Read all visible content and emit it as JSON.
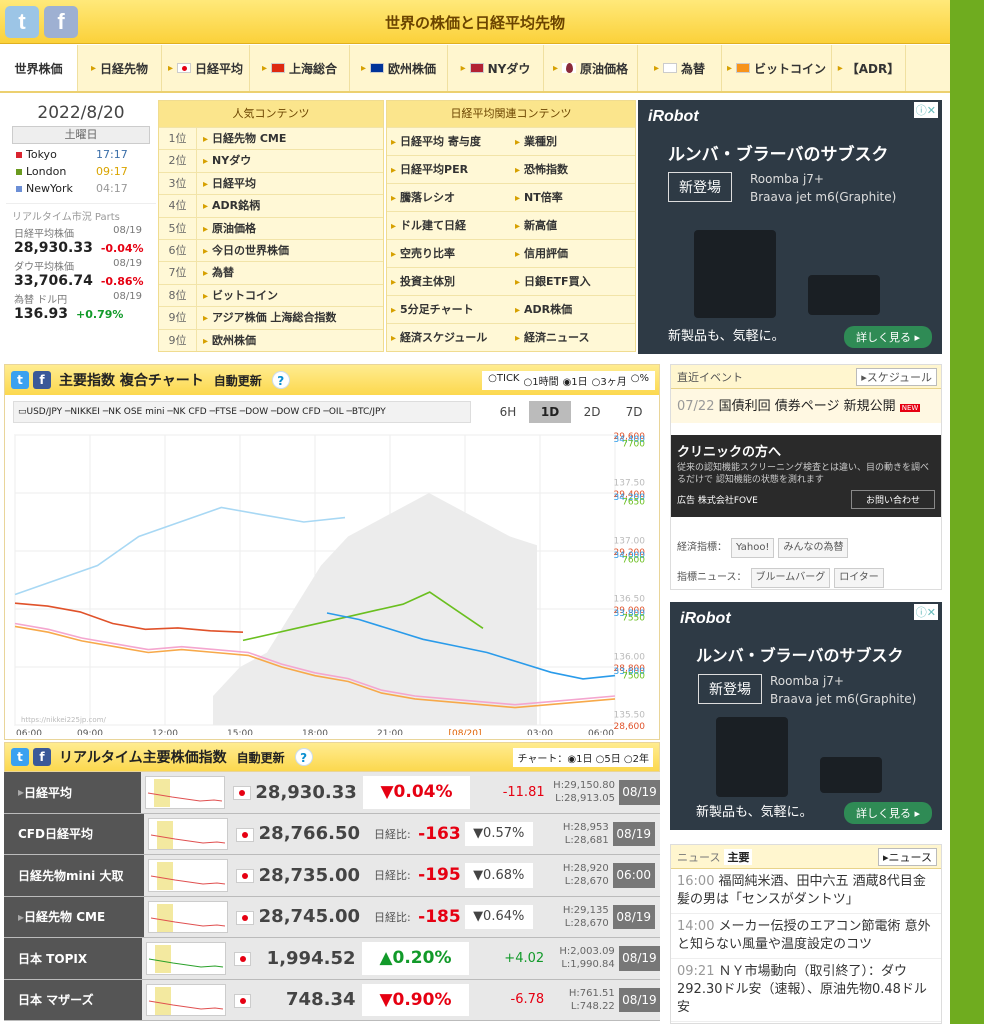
{
  "header": {
    "title": "世界の株価と日経平均先物",
    "twitter_label": "t",
    "facebook_label": "f"
  },
  "nav": [
    {
      "label": "世界株価",
      "flag": ""
    },
    {
      "label": "日経先物",
      "flag": ""
    },
    {
      "label": "日経平均",
      "flag": "jp"
    },
    {
      "label": "上海総合",
      "flag": "cn"
    },
    {
      "label": "欧州株価",
      "flag": "eu"
    },
    {
      "label": "NYダウ",
      "flag": "us"
    },
    {
      "label": "原油価格",
      "flag": "oil"
    },
    {
      "label": "為替",
      "flag": "fx"
    },
    {
      "label": "ビットコイン",
      "flag": "btc"
    },
    {
      "label": "【ADR】",
      "flag": ""
    }
  ],
  "clock": {
    "date": "2022/8/20",
    "weekday": "土曜日",
    "cities": [
      {
        "name": "Tokyo",
        "time": "17:17",
        "color": "#d9242f"
      },
      {
        "name": "London",
        "time": "09:17",
        "color": "#6a9a1f"
      },
      {
        "name": "NewYork",
        "time": "04:17",
        "color": "#6c8fd6"
      }
    ],
    "parts_label": "リアルタイム市況 Parts"
  },
  "mini_quotes": [
    {
      "label": "日経平均株価",
      "date": "08/19",
      "value": "28,930.33",
      "change": "-0.04%",
      "dir": "down"
    },
    {
      "label": "ダウ平均株価",
      "date": "08/19",
      "value": "33,706.74",
      "change": "-0.86%",
      "dir": "down"
    },
    {
      "label": "為替 ドル円",
      "date": "08/19",
      "value": "136.93",
      "change": "+0.79%",
      "dir": "up"
    }
  ],
  "popular": {
    "title": "人気コンテンツ",
    "items": [
      {
        "rank": "1位",
        "label": "日経先物 CME"
      },
      {
        "rank": "2位",
        "label": "NYダウ"
      },
      {
        "rank": "3位",
        "label": "日経平均"
      },
      {
        "rank": "4位",
        "label": "ADR銘柄"
      },
      {
        "rank": "5位",
        "label": "原油価格"
      },
      {
        "rank": "6位",
        "label": "今日の世界株価"
      },
      {
        "rank": "7位",
        "label": "為替"
      },
      {
        "rank": "8位",
        "label": "ビットコイン"
      },
      {
        "rank": "9位",
        "label": "アジア株価 上海総合指数"
      },
      {
        "rank": "9位",
        "label": "欧州株価"
      }
    ]
  },
  "related": {
    "title": "日経平均関連コンテンツ",
    "items": [
      "日経平均 寄与度",
      "業種別",
      "日経平均PER",
      "恐怖指数",
      "騰落レシオ",
      "NT倍率",
      "ドル建て日経",
      "新高値",
      "空売り比率",
      "信用評価",
      "投資主体別",
      "日銀ETF買入",
      "5分足チャート",
      "ADR株価",
      "経済スケジュール",
      "経済ニュース"
    ]
  },
  "ad": {
    "logo": "iRobot",
    "headline": "ルンバ・ブラーバのサブスク",
    "badge": "新登場",
    "model1": "Roomba j7+",
    "model2": "Braava jet m6(Graphite)",
    "tagline": "新製品も、気軽に。",
    "cta": "詳しく見る ▸",
    "close": "ⓘ✕"
  },
  "chart": {
    "title": "主要指数 複合チャート",
    "auto": "自動更新",
    "help": "?",
    "periods": [
      "○TICK",
      "○1時間",
      "◉1日",
      "○3ヶ月",
      "○%"
    ],
    "legend": "▭USD/JPY ─NIKKEI ─NK OSE mini ─NK CFD ─FTSE ─DOW ─DOW CFD ─OIL ─BTC/JPY",
    "ranges": [
      "6H",
      "1D",
      "2D",
      "7D"
    ],
    "selected_range": "1D",
    "watermark": "https://nikkei225jp.com/"
  },
  "chart_data": {
    "type": "line",
    "x_labels": [
      "06:00",
      "09:00",
      "12:00",
      "15:00",
      "18:00",
      "21:00",
      "[08/20]",
      "03:00",
      "06:00"
    ],
    "y_nikkei": [
      "29,600",
      "29,400",
      "29,200",
      "29,000",
      "28,800",
      "28,600"
    ],
    "y_dow": [
      "34,400",
      "34,200",
      "34,000",
      "33,800",
      "33,600"
    ],
    "y_ftse": [
      "7700",
      "7650",
      "7600",
      "7550",
      "7500"
    ],
    "y_usdjpy": [
      "137.50",
      "137.00",
      "136.50",
      "136.00",
      "135.50"
    ],
    "series": [
      {
        "name": "NIKKEI",
        "color": "#e0522a",
        "values": [
          29020,
          29010,
          28990,
          28950,
          28930,
          28935,
          28925,
          28920
        ]
      },
      {
        "name": "NK CFD",
        "color": "#f4a6cf",
        "values": [
          28950,
          28930,
          28900,
          28880,
          28860,
          28870,
          28860,
          28850,
          28810,
          28780,
          28760,
          28720,
          28700,
          28690,
          28680,
          28670,
          28680,
          28690,
          28700
        ]
      },
      {
        "name": "NK OSE mini",
        "color": "#f7a94a",
        "values": [
          28940,
          28920,
          28890,
          28870,
          28850,
          28860,
          28850,
          28840,
          28800,
          28770,
          28750,
          28710,
          28690,
          28680,
          28670,
          28660,
          28670,
          28680,
          28690
        ]
      },
      {
        "name": "FTSE",
        "color": "#6abf1f",
        "values": [
          7550,
          7555,
          7560,
          7565,
          7570,
          7575,
          7580,
          7590,
          7575,
          7560
        ]
      },
      {
        "name": "DOW",
        "color": "#2a9bea",
        "values": [
          33900,
          33880,
          33850,
          33820,
          33800,
          33780,
          33750,
          33720,
          33700,
          33710
        ]
      },
      {
        "name": "USD/JPY",
        "color": "#a8d8f4",
        "values": [
          136.4,
          136.5,
          136.6,
          136.8,
          136.9,
          137.0,
          136.95,
          136.9,
          136.93
        ]
      }
    ]
  },
  "realtime": {
    "title": "リアルタイム主要株価指数",
    "auto": "自動更新",
    "help": "?",
    "chart_opts": "チャート：◉1日 ○5日 ○2年",
    "rows": [
      {
        "name": "日経平均",
        "value": "28,930.33",
        "cmp": "",
        "pct": "▼0.04%",
        "diff": "-11.81",
        "high": "H:29,150.80",
        "low": "L:28,913.05",
        "date": "08/19",
        "dir": "down"
      },
      {
        "name": "CFD日経平均",
        "value": "28,766.50",
        "cmp": "日経比:",
        "pct": "-163",
        "pct2": "▼0.57%",
        "high": "H:28,953",
        "low": "L:28,681",
        "date": "08/19",
        "dir": "down"
      },
      {
        "name": "日経先物mini 大取",
        "value": "28,735.00",
        "cmp": "日経比:",
        "pct": "-195",
        "pct2": "▼0.68%",
        "high": "H:28,920",
        "low": "L:28,670",
        "date": "06:00",
        "dir": "down"
      },
      {
        "name": "日経先物 CME",
        "value": "28,745.00",
        "cmp": "日経比:",
        "pct": "-185",
        "pct2": "▼0.64%",
        "high": "H:29,135",
        "low": "L:28,670",
        "date": "08/19",
        "dir": "down"
      },
      {
        "name": "日本 TOPIX",
        "value": "1,994.52",
        "cmp": "",
        "pct": "▲0.20%",
        "diff": "+4.02",
        "high": "H:2,003.09",
        "low": "L:1,990.84",
        "date": "08/19",
        "dir": "up"
      },
      {
        "name": "日本 マザーズ",
        "value": "748.34",
        "cmp": "",
        "pct": "▼0.90%",
        "diff": "-6.78",
        "high": "H:761.51",
        "low": "L:748.22",
        "date": "08/19",
        "dir": "down"
      }
    ]
  },
  "events": {
    "title": "直近イベント",
    "link": "▸スケジュール",
    "date": "07/22",
    "text": "国債利回 債券ページ 新規公開",
    "new": "NEW",
    "clinic_title": "クリニックの方へ",
    "clinic_text": "従来の認知機能スクリーニング検査とは違い、目の動きを調べるだけで 認知機能の状態を測れます",
    "clinic_ad": "広告 株式会社FOVE",
    "clinic_cta": "お問い合わせ",
    "link_label1": "経済指標：",
    "link_label2": "指標ニュース：",
    "links": [
      "Yahoo!",
      "みんなの為替",
      "ブルームバーグ",
      "ロイター"
    ]
  },
  "news": {
    "tab1": "ニュース",
    "tab2": "主要",
    "link": "▸ニュース",
    "items": [
      {
        "time": "16:00",
        "text": "福岡純米酒、田中六五 酒蔵8代目金髪の男は「センスがダントツ」"
      },
      {
        "time": "14:00",
        "text": "メーカー伝授のエアコン節電術 意外と知らない風量や温度設定のコツ"
      },
      {
        "time": "09:21",
        "text": "ＮＹ市場動向（取引終了）：ダウ292.30ドル安（速報）、原油先物0.48ドル安"
      }
    ]
  }
}
